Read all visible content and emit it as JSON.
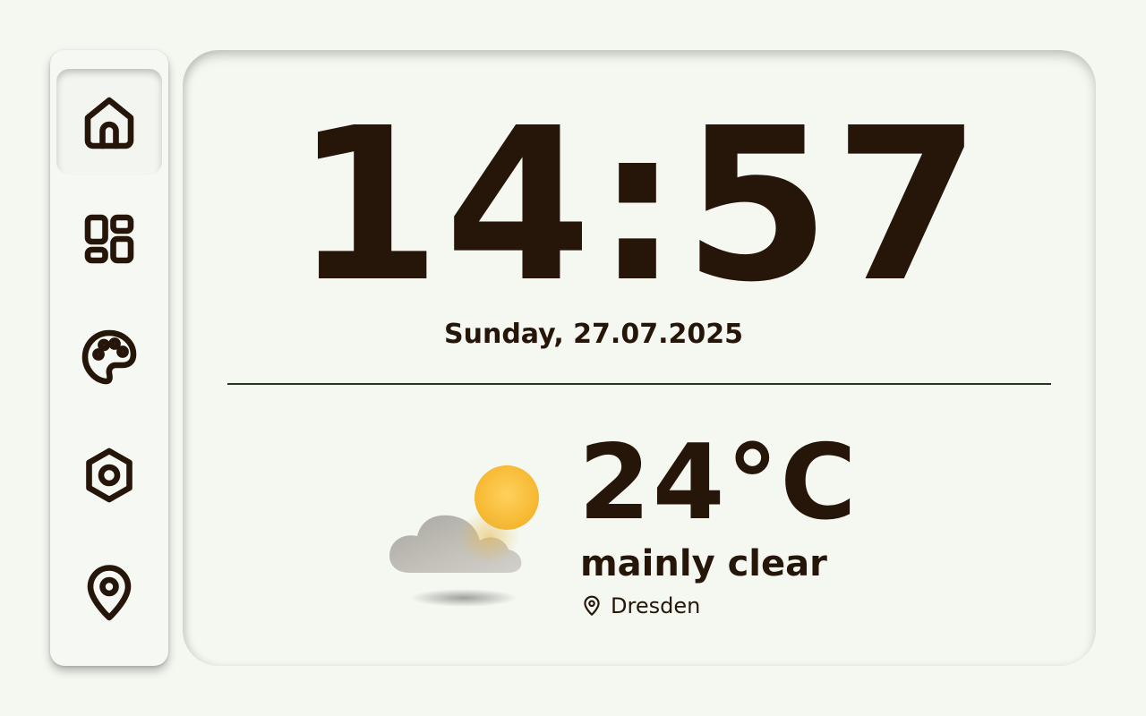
{
  "nav": {
    "items": [
      {
        "icon": "home-icon",
        "active": true
      },
      {
        "icon": "dashboard-icon",
        "active": false
      },
      {
        "icon": "palette-icon",
        "active": false
      },
      {
        "icon": "settings-icon",
        "active": false
      },
      {
        "icon": "location-pin-icon",
        "active": false
      }
    ]
  },
  "clock": {
    "time": "14:57",
    "date": "Sunday, 27.07.2025"
  },
  "weather": {
    "icon": "partly-cloudy-icon",
    "temperature": "24°C",
    "condition": "mainly clear",
    "location": "Dresden"
  },
  "colors": {
    "background": "#f4f8f1",
    "text": "#261509",
    "divider": "#1f3a1a",
    "sun": "#f7b733"
  }
}
